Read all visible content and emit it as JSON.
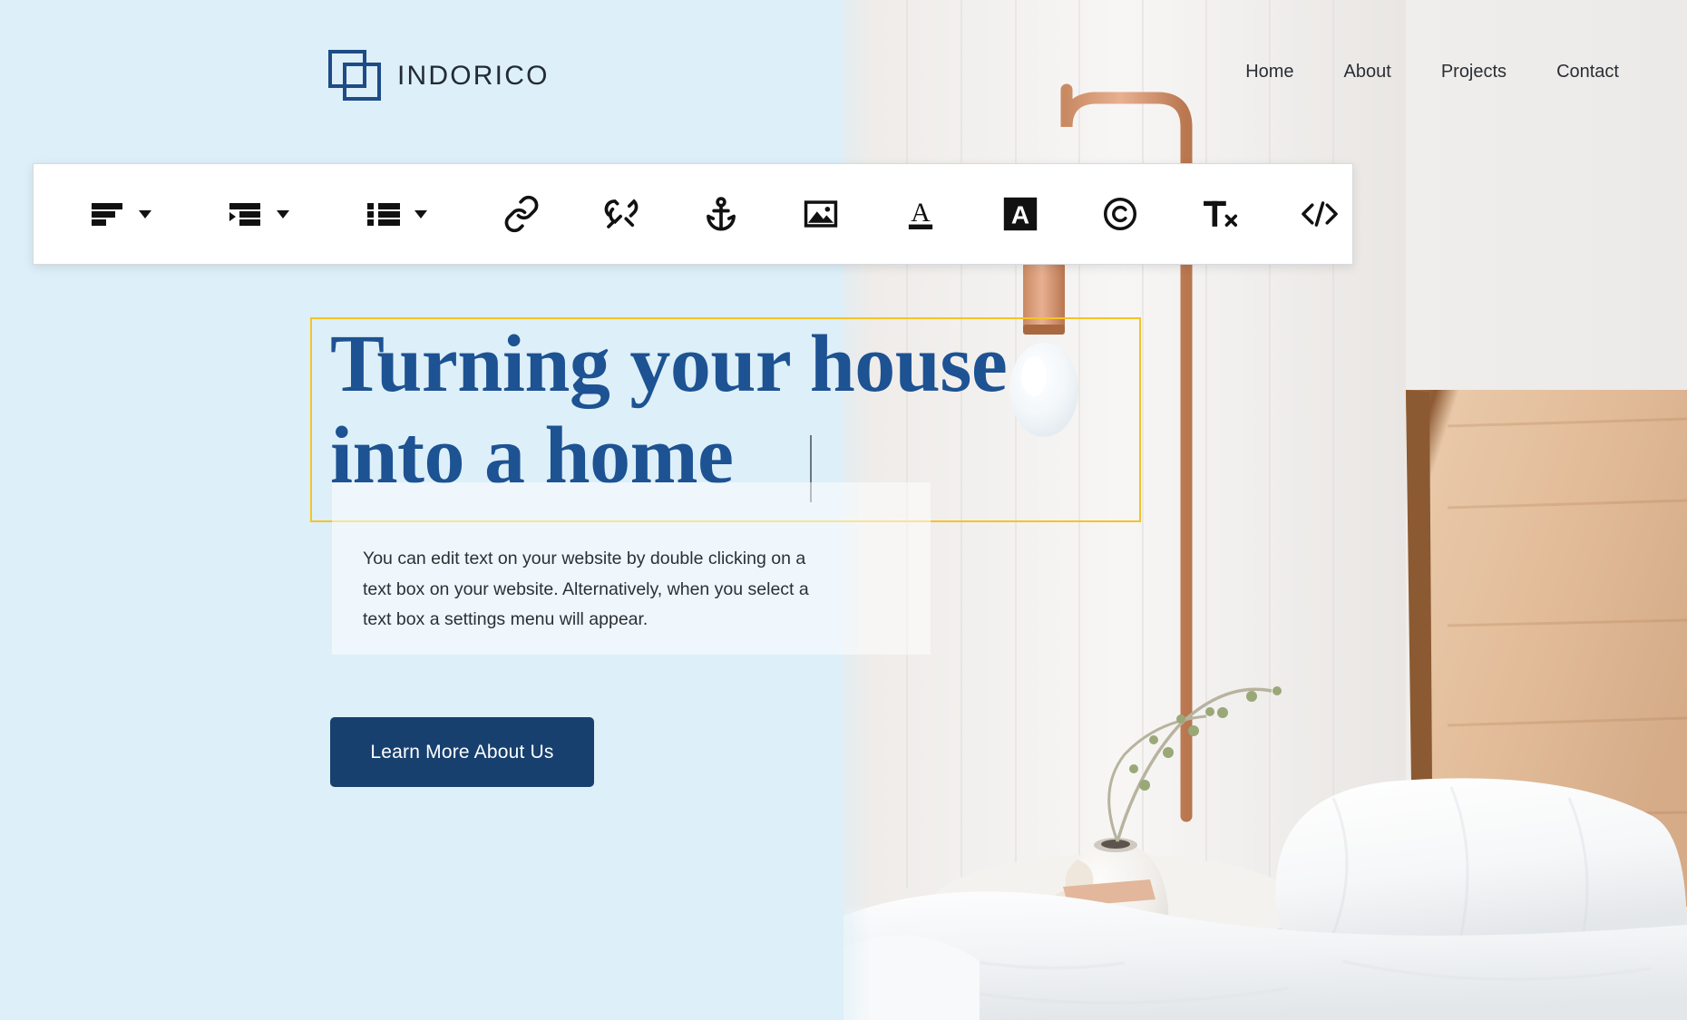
{
  "header": {
    "brand": {
      "name": "INDORICO",
      "logo_icon": "overlapping-squares-icon",
      "logo_color": "#1d4c86"
    },
    "nav_items": [
      {
        "label": "Home"
      },
      {
        "label": "About"
      },
      {
        "label": "Projects"
      },
      {
        "label": "Contact"
      }
    ]
  },
  "toolbar": {
    "aria_label": "Text editing toolbar",
    "items": [
      {
        "name": "align-left-icon",
        "label": "Align left",
        "has_dropdown": true
      },
      {
        "name": "indent-icon",
        "label": "Indent",
        "has_dropdown": true
      },
      {
        "name": "bulleted-list-icon",
        "label": "Bulleted list",
        "has_dropdown": true
      },
      {
        "name": "link-icon",
        "label": "Insert link",
        "has_dropdown": false
      },
      {
        "name": "unlink-icon",
        "label": "Remove link",
        "has_dropdown": false
      },
      {
        "name": "anchor-icon",
        "label": "Anchor",
        "has_dropdown": false
      },
      {
        "name": "image-icon",
        "label": "Insert image",
        "has_dropdown": false
      },
      {
        "name": "text-color-icon",
        "label": "Text color",
        "has_dropdown": false
      },
      {
        "name": "highlight-color-icon",
        "label": "Highlight color",
        "has_dropdown": false,
        "active": true
      },
      {
        "name": "copyright-icon",
        "label": "Insert symbol",
        "has_dropdown": false
      },
      {
        "name": "clear-formatting-icon",
        "label": "Clear formatting",
        "has_dropdown": false
      },
      {
        "name": "html-code-icon",
        "label": "Edit HTML",
        "has_dropdown": false
      }
    ]
  },
  "hero": {
    "heading_line_1": "Turning your house",
    "heading_line_2": "into a home",
    "heading_color": "#1d5293",
    "selection_border_color": "#f5c327",
    "body_text": "You can edit text on your website by double clicking on a text box on your website. Alternatively, when you select a text box a settings menu will appear.",
    "cta_label": "Learn More About Us",
    "cta_color": "#17406f"
  },
  "theme": {
    "panel_tint": "#ddeff8",
    "page_background": "#e6e3e0"
  }
}
